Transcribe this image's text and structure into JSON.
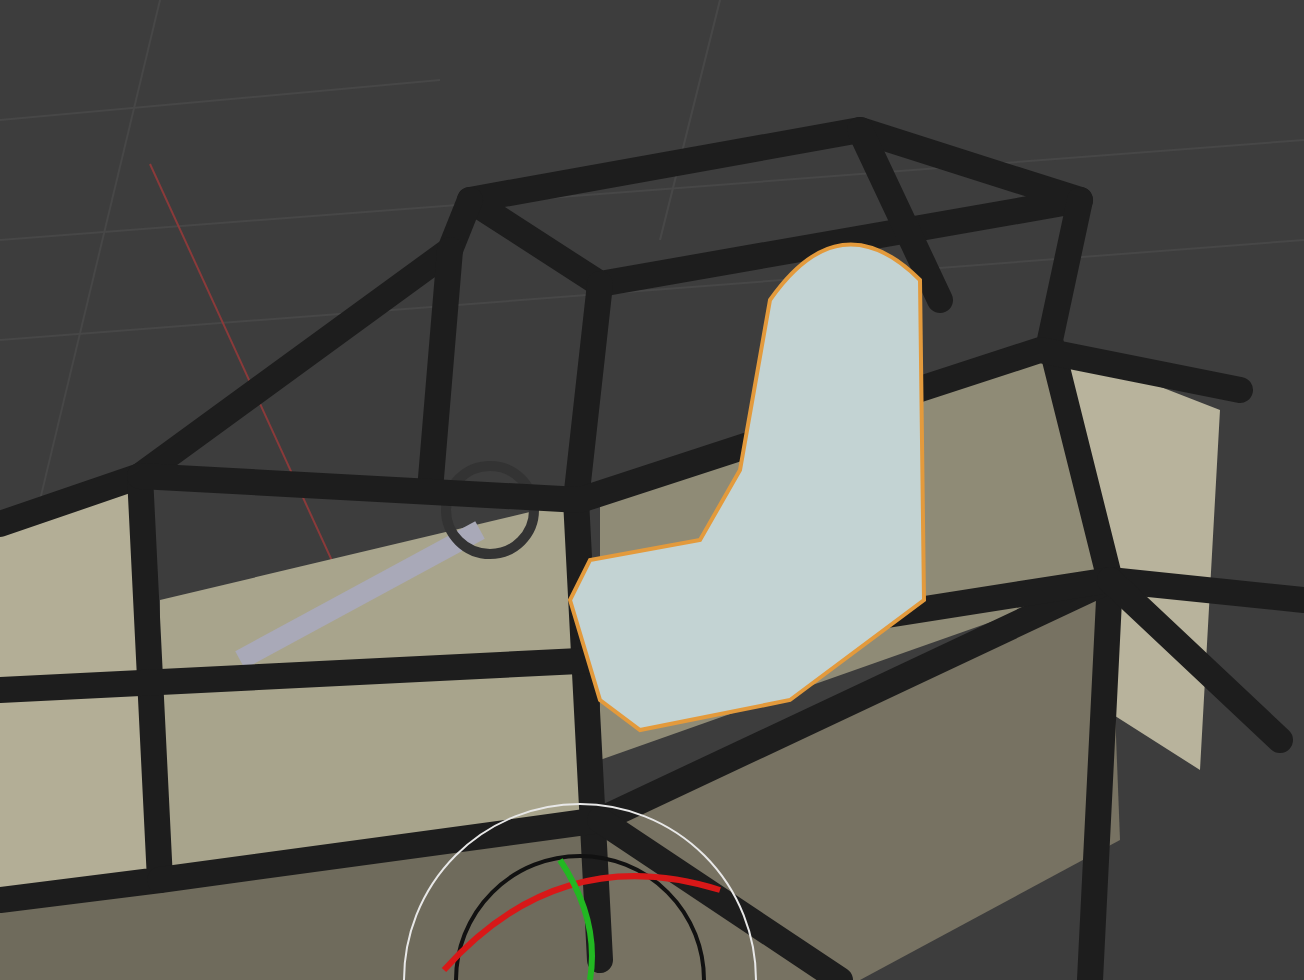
{
  "viewport": {
    "seat_selected": true,
    "gizmo_visible": true
  }
}
